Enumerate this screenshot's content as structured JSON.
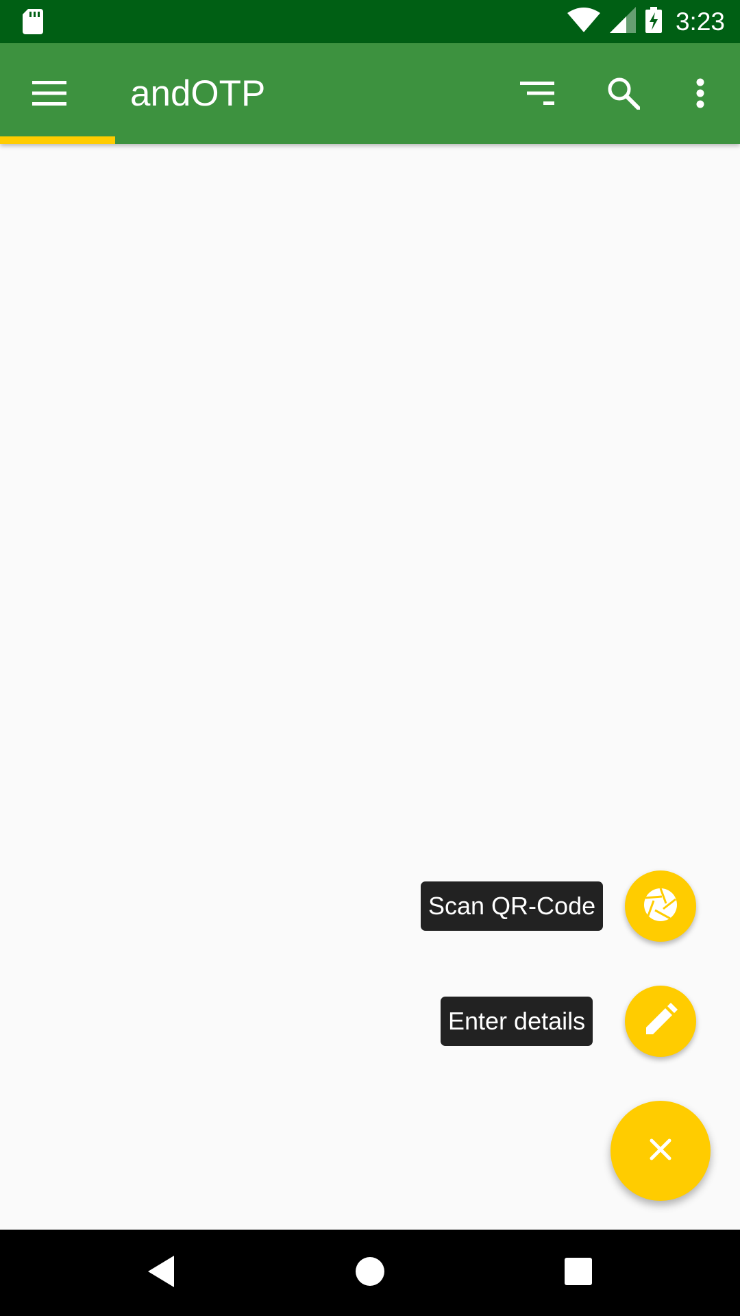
{
  "status_bar": {
    "time": "3:23",
    "icons": [
      "sd-card-icon",
      "wifi-icon",
      "cell-signal-icon",
      "battery-charging-icon"
    ]
  },
  "app_bar": {
    "title": "andOTP",
    "icons": [
      "menu-icon",
      "sort-icon",
      "search-icon",
      "more-vert-icon"
    ]
  },
  "fab_menu": {
    "items": [
      {
        "label": "Scan QR-Code",
        "icon": "camera-shutter-icon"
      },
      {
        "label": "Enter details",
        "icon": "pencil-icon"
      }
    ],
    "main_icon": "close-icon"
  },
  "nav_bar": {
    "icons": [
      "back-icon",
      "home-icon",
      "recents-icon"
    ]
  },
  "colors": {
    "status_bar": "#005f14",
    "app_bar": "#3d923f",
    "accent": "#ffcc00",
    "background": "#fafafa",
    "label_bg": "#222222"
  }
}
